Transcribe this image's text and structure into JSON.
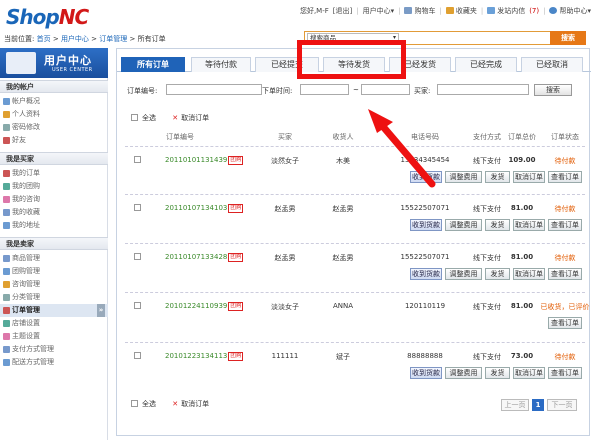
{
  "header": {
    "logo_part1": "Shop",
    "logo_part2": "NC",
    "greeting": "您好,M-F",
    "logout": "[退出]",
    "user_center": "用户中心",
    "user_center_caret": "▾",
    "cart": "购物车",
    "favorites": "收藏夹",
    "messages": "发站内信",
    "messages_count": "(7)",
    "help": "帮助中心",
    "help_caret": "▾",
    "sep": "|"
  },
  "breadcrumb": {
    "prefix": "当前位置:",
    "home": "首页",
    "user_center": "用户中心",
    "orders": "订单管理",
    "current": "所有订单",
    "arrow": ">"
  },
  "search": {
    "category": "搜索商品",
    "caret": "▾",
    "button": "搜索"
  },
  "sidebar": {
    "title": "用户中心",
    "subtitle": "USER CENTER",
    "groups": [
      {
        "label": "我的帐户",
        "items": [
          "帐户概况",
          "个人资料",
          "密码修改",
          "好友"
        ]
      },
      {
        "label": "我是买家",
        "items": [
          "我的订单",
          "我的团购",
          "我的咨询",
          "我的收藏",
          "我的地址"
        ]
      },
      {
        "label": "我是卖家",
        "items": [
          "商品管理",
          "团购管理",
          "咨询管理",
          "分类管理",
          "订单管理",
          "店铺设置",
          "主题设置",
          "支付方式管理",
          "配送方式管理"
        ]
      }
    ],
    "active_arrow": "»"
  },
  "tabs": [
    "所有订单",
    "等待付款",
    "已经提交",
    "等待发货",
    "已经发货",
    "已经完成",
    "已经取消"
  ],
  "filter": {
    "order_no_label": "订单编号:",
    "time_label": "下单时间:",
    "range_sep": "~",
    "buyer_label": "买家:",
    "search_button": "搜索"
  },
  "bulk": {
    "select_all": "全选",
    "cancel": "取消订单",
    "x": "✕"
  },
  "table": {
    "headers": [
      "订单编号",
      "买家",
      "收货人",
      "电话号码",
      "支付方式",
      "订单总价",
      "订单状态"
    ],
    "rows": [
      {
        "no": "20110101131439",
        "tag": "团购",
        "buyer": "淡然女子",
        "receiver": "木美",
        "phone": "13134345454",
        "pay": "线下支付",
        "total": "109.00",
        "status": "待付款",
        "actions": [
          "收到货款",
          "调整费用",
          "发货",
          "取消订单",
          "查看订单"
        ]
      },
      {
        "no": "20110107134103",
        "tag": "团购",
        "buyer": "赵孟男",
        "receiver": "赵孟男",
        "phone": "15522507071",
        "pay": "线下支付",
        "total": "81.00",
        "status": "待付款",
        "actions": [
          "收到货款",
          "调整费用",
          "发货",
          "取消订单",
          "查看订单"
        ]
      },
      {
        "no": "20110107133428",
        "tag": "团购",
        "buyer": "赵孟男",
        "receiver": "赵孟男",
        "phone": "15522507071",
        "pay": "线下支付",
        "total": "81.00",
        "status": "待付款",
        "actions": [
          "收到货款",
          "调整费用",
          "发货",
          "取消订单",
          "查看订单"
        ]
      },
      {
        "no": "20101224110939",
        "tag": "团购",
        "buyer": "淡淡女子",
        "receiver": "ANNA",
        "phone": "120110119",
        "pay": "线下支付",
        "total": "81.00",
        "status": "已收货，已评价",
        "actions": [
          "查看订单"
        ]
      },
      {
        "no": "20101223134113",
        "tag": "团购",
        "buyer": "111111",
        "receiver": "斌子",
        "phone": "88888888",
        "pay": "线下支付",
        "total": "73.00",
        "status": "待付款",
        "actions": [
          "收到货款",
          "调整费用",
          "发货",
          "取消订单",
          "查看订单"
        ]
      }
    ]
  },
  "pager": {
    "prev": "上一页",
    "current": "1",
    "next": "下一页"
  },
  "colors": {
    "brand": "#1f63b8",
    "logo_red": "#d21818",
    "status": "#e25a00",
    "annotation": "#ee1111",
    "search_btn": "#e67817"
  }
}
